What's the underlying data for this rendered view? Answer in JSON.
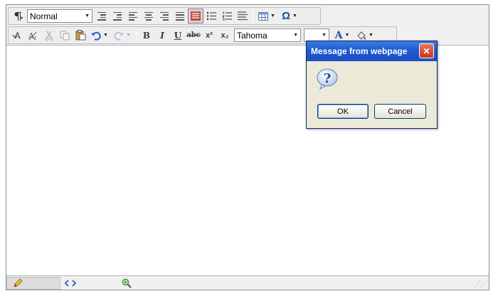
{
  "toolbar": {
    "paragraph_style": "Normal",
    "font_name": "Tahoma",
    "font_size": "",
    "row1_icons": [
      "paragraph-icon",
      "outdent-icon",
      "indent-icon",
      "align-left-icon",
      "align-center-icon",
      "align-right-icon",
      "justify-icon",
      "highlight-icon",
      "bullet-list-icon",
      "numbered-list-icon",
      "line-spacing-icon",
      "table-icon",
      "special-character-icon"
    ],
    "glyph_omega": "Ω",
    "glyph_bold": "B",
    "glyph_italic": "I",
    "glyph_underline": "U",
    "glyph_strike": "abc",
    "glyph_superscript": "x²",
    "glyph_subscript": "x₂",
    "glyph_fontcolor": "A"
  },
  "dialog": {
    "title": "Message from webpage",
    "message": "",
    "ok_label": "OK",
    "cancel_label": "Cancel",
    "icon": "question-icon",
    "close_glyph": "✕"
  },
  "statusbar": {
    "design_icon": "pencil-icon",
    "html_icon": "code-icon",
    "preview_icon": "magnifier-icon"
  },
  "colors": {
    "titlebar": "#1c5ad2",
    "dialog_bg": "#ece9d8",
    "toolbar_bg": "#f0f0f0"
  }
}
